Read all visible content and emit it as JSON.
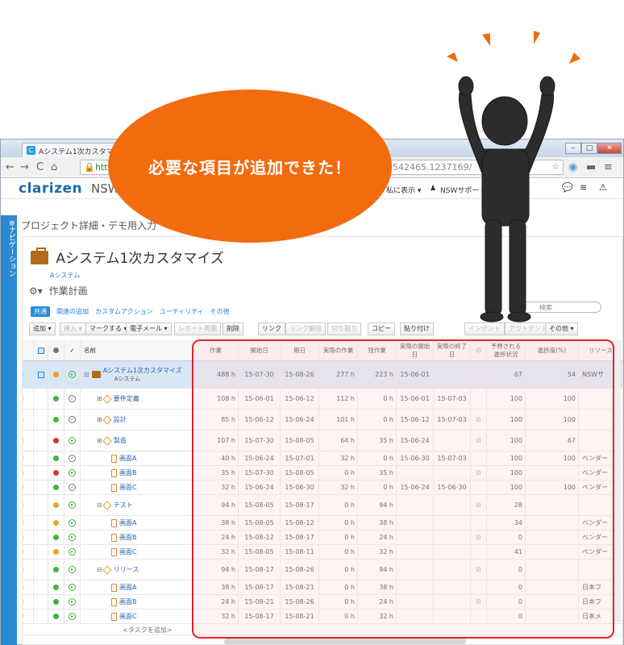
{
  "browser": {
    "tab_title": "Aシステム1次カスタマイ",
    "url_visible_left": "htt",
    "url_visible_right": "3542465.1237169/"
  },
  "app": {
    "logo": "clarizen",
    "workspace": "NSW L",
    "menu_show": "私に表示 ▾",
    "menu_support": "NSWサポート ▾",
    "side_nav_label": "⊕ナビゲーション"
  },
  "callout": {
    "text": "必要な項目が追加できた！"
  },
  "page": {
    "breadcrumb": "プロジェクト詳細・デモ用入力",
    "title": "Aシステム1次カスタマイズ",
    "subtitle": "Aシステム",
    "section": "作業計画"
  },
  "tabs": [
    "共通",
    "関連の追加",
    "カスタムアクション",
    "ユーティリティ",
    "その他"
  ],
  "search_placeholder": "検索",
  "toolbar": [
    "追加 ▾",
    "挿入 ▾",
    "マークする ▾",
    "電子メール ▾",
    "レポート再開",
    "削除",
    "リンク",
    "リンク解除",
    "切り取り",
    "コピー",
    "貼り付け",
    "インデント",
    "アウトデント",
    "その他 ▾"
  ],
  "columns": {
    "name": "名前",
    "work": "作業",
    "start": "開始日",
    "due": "期日",
    "actual_work": "実際の作業",
    "remaining": "残作業",
    "actual_start_1": "実際の開始",
    "actual_start_2": "日",
    "actual_end_1": "実際の終了",
    "actual_end_2": "日",
    "expected_1": "予想される",
    "expected_2": "進捗状況",
    "progress": "進捗度(%)",
    "resource": "リソース"
  },
  "rows": [
    {
      "name": "Aシステム1次カスタマイズ",
      "sub": "Aシステム",
      "level": 0,
      "kind": "project",
      "status": "orange",
      "work": "488 h",
      "start": "15-07-30",
      "due": "15-08-26",
      "actual_work": "277 h",
      "remaining": "223 h",
      "astart": "15-06-01",
      "aend": "",
      "link": false,
      "expected": "67",
      "progress": "54",
      "resource": "NSWサ"
    },
    {
      "name": "要件定義",
      "level": 1,
      "kind": "milestone",
      "status": "green",
      "work": "108 h",
      "start": "15-06-01",
      "due": "15-06-12",
      "actual_work": "112 h",
      "remaining": "0 h",
      "astart": "15-06-01",
      "aend": "15-07-03",
      "link": false,
      "expected": "100",
      "progress": "100",
      "resource": ""
    },
    {
      "name": "設計",
      "level": 1,
      "kind": "milestone",
      "status": "green",
      "work": "85 h",
      "start": "15-06-12",
      "due": "15-06-24",
      "actual_work": "101 h",
      "remaining": "0 h",
      "astart": "15-06-12",
      "aend": "15-07-03",
      "link": true,
      "expected": "100",
      "progress": "100",
      "resource": ""
    },
    {
      "name": "製造",
      "level": 1,
      "kind": "milestone",
      "status": "red",
      "work": "107 h",
      "start": "15-07-30",
      "due": "15-08-05",
      "actual_work": "64 h",
      "remaining": "35 h",
      "astart": "15-06-24",
      "aend": "",
      "link": true,
      "expected": "100",
      "progress": "67",
      "resource": ""
    },
    {
      "name": "画面A",
      "level": 2,
      "kind": "task",
      "status": "green",
      "work": "40 h",
      "start": "15-06-24",
      "due": "15-07-01",
      "actual_work": "32 h",
      "remaining": "0 h",
      "astart": "15-06-30",
      "aend": "15-07-03",
      "link": false,
      "expected": "100",
      "progress": "100",
      "resource": "ベンダー"
    },
    {
      "name": "画面B",
      "level": 2,
      "kind": "task",
      "status": "red",
      "work": "35 h",
      "start": "15-07-30",
      "due": "15-08-05",
      "actual_work": "0 h",
      "remaining": "35 h",
      "astart": "",
      "aend": "",
      "link": true,
      "expected": "100",
      "progress": "",
      "resource": "ベンダー"
    },
    {
      "name": "画面C",
      "level": 2,
      "kind": "task",
      "status": "green",
      "work": "32 h",
      "start": "15-06-24",
      "due": "15-06-30",
      "actual_work": "32 h",
      "remaining": "0 h",
      "astart": "15-06-24",
      "aend": "15-06-30",
      "link": false,
      "expected": "100",
      "progress": "100",
      "resource": "ベンダー"
    },
    {
      "name": "テスト",
      "level": 1,
      "kind": "milestone",
      "status": "orange",
      "work": "94 h",
      "start": "15-08-05",
      "due": "15-08-17",
      "actual_work": "0 h",
      "remaining": "94 h",
      "astart": "",
      "aend": "",
      "link": true,
      "expected": "28",
      "progress": "",
      "resource": ""
    },
    {
      "name": "画面A",
      "level": 2,
      "kind": "task",
      "status": "orange",
      "work": "38 h",
      "start": "15-08-05",
      "due": "15-08-12",
      "actual_work": "0 h",
      "remaining": "38 h",
      "astart": "",
      "aend": "",
      "link": false,
      "expected": "34",
      "progress": "",
      "resource": "ベンダー"
    },
    {
      "name": "画面B",
      "level": 2,
      "kind": "task",
      "status": "green",
      "work": "24 h",
      "start": "15-08-12",
      "due": "15-08-17",
      "actual_work": "0 h",
      "remaining": "24 h",
      "astart": "",
      "aend": "",
      "link": true,
      "expected": "0",
      "progress": "",
      "resource": "ベンダー"
    },
    {
      "name": "画面C",
      "level": 2,
      "kind": "task",
      "status": "orange",
      "work": "32 h",
      "start": "15-08-05",
      "due": "15-08-11",
      "actual_work": "0 h",
      "remaining": "32 h",
      "astart": "",
      "aend": "",
      "link": false,
      "expected": "41",
      "progress": "",
      "resource": "ベンダー"
    },
    {
      "name": "リリース",
      "level": 1,
      "kind": "milestone",
      "status": "green",
      "work": "94 h",
      "start": "15-08-17",
      "due": "15-08-26",
      "actual_work": "0 h",
      "remaining": "94 h",
      "astart": "",
      "aend": "",
      "link": true,
      "expected": "0",
      "progress": "",
      "resource": ""
    },
    {
      "name": "画面A",
      "level": 2,
      "kind": "task",
      "status": "green",
      "work": "38 h",
      "start": "15-08-17",
      "due": "15-08-21",
      "actual_work": "0 h",
      "remaining": "38 h",
      "astart": "",
      "aend": "",
      "link": false,
      "expected": "0",
      "progress": "",
      "resource": "日本フ"
    },
    {
      "name": "画面B",
      "level": 2,
      "kind": "task",
      "status": "green",
      "work": "24 h",
      "start": "15-08-21",
      "due": "15-08-26",
      "actual_work": "0 h",
      "remaining": "24 h",
      "astart": "",
      "aend": "",
      "link": true,
      "expected": "0",
      "progress": "",
      "resource": "日本フ"
    },
    {
      "name": "画面C",
      "level": 2,
      "kind": "task",
      "status": "green",
      "work": "32 h",
      "start": "15-08-17",
      "due": "15-08-21",
      "actual_work": "0 h",
      "remaining": "32 h",
      "astart": "",
      "aend": "",
      "link": false,
      "expected": "0",
      "progress": "",
      "resource": "日本メ"
    }
  ],
  "add_task_label": "<タスクを追加>",
  "colors": {
    "green": "#3cb63c",
    "orange": "#f1a21f",
    "red": "#d8302b",
    "accent": "#2a8ad8",
    "callout": "#f26b0f",
    "highlight": "#e4232d"
  }
}
